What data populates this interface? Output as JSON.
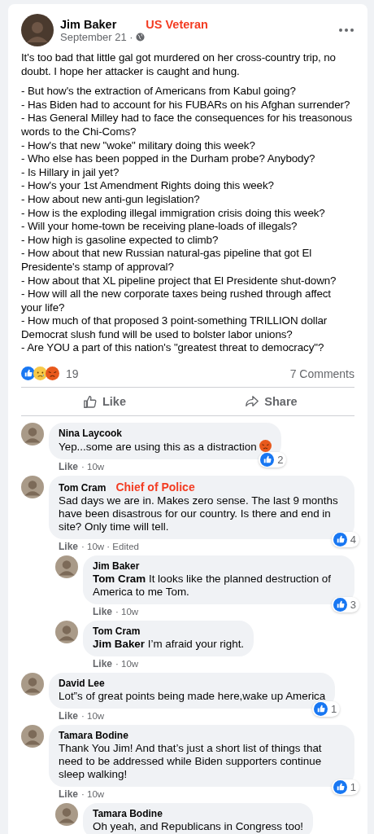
{
  "post": {
    "author": "Jim Baker",
    "annotation": "US Veteran",
    "date": "September 21 ·",
    "text": "It's too bad that little gal got murdered on her cross-country trip, no doubt. I hope her attacker is caught and hung.",
    "list": [
      "- But how's the extraction of Americans from Kabul going?",
      "- Has Biden had to account for his FUBARs on his Afghan surrender?",
      "- Has General Milley had to face the consequences for his treasonous words to the Chi-Coms?",
      "- How's that new \"woke\" military doing this week?",
      "- Who else has been popped in the Durham probe? Anybody?",
      "- Is Hillary in jail yet?",
      "- How's your 1st Amendment Rights doing this week?",
      "- How about new anti-gun legislation?",
      "- How is the exploding illegal immigration crisis doing this week?",
      "- Will your home-town be receiving plane-loads of illegals?",
      "- How high is gasoline expected to climb?",
      "- How about that new Russian natural-gas pipeline that got El Presidente's stamp of approval?",
      "- How about that XL pipeline project that El Presidente shut-down?",
      "- How will all the new corporate taxes being rushed through affect your life?",
      "- How much of that proposed 3 point-something TRILLION dollar Democrat slush fund will be used to bolster labor unions?",
      "- Are YOU a part of this nation's \"greatest threat to democracy\"?"
    ],
    "reactions": [
      {
        "kind": "like"
      },
      {
        "kind": "sad"
      },
      {
        "kind": "angry"
      }
    ],
    "reaction_count": "19",
    "comment_count": "7 Comments",
    "actions": [
      {
        "kind": "like",
        "label": "Like"
      },
      {
        "kind": "share",
        "label": "Share"
      }
    ]
  },
  "comments": [
    {
      "author": "Nina Laycook",
      "text": "Yep...some are using this as a distraction",
      "trailing_icon": {
        "kind": "angry"
      },
      "likes": "2",
      "action": "Like",
      "meta": "· 10w"
    },
    {
      "author": "Tom Cram",
      "annotation": "Chief of Police",
      "text": "Sad days we are in. Makes zero sense. The last 9 months have been disastrous for our country. Is there and end in site? Only time will tell.",
      "likes": "4",
      "action": "Like",
      "meta": "· 10w · Edited",
      "children": [
        {
          "author": "Jim Baker",
          "text": "**Tom Cram** It looks like the planned destruction of America to me Tom.",
          "likes": "3",
          "action": "Like",
          "meta": "· 10w"
        },
        {
          "author": "Tom Cram",
          "text": "**Jim Baker** I’m afraid your right.",
          "action": "Like",
          "meta": "· 10w"
        }
      ]
    },
    {
      "author": "David Lee",
      "text": "Lot”s of great points being made here,wake up America",
      "likes": "1",
      "action": "Like",
      "meta": "· 10w"
    },
    {
      "author": "Tamara Bodine",
      "text": "Thank You Jim! And that’s just a short list of things that need to be addressed while Biden supporters continue sleep walking!",
      "likes": "1",
      "action": "Like",
      "meta": "· 10w",
      "children": [
        {
          "author": "Tamara Bodine",
          "text": "Oh yeah, and Republicans in Congress too!"
        }
      ]
    }
  ]
}
